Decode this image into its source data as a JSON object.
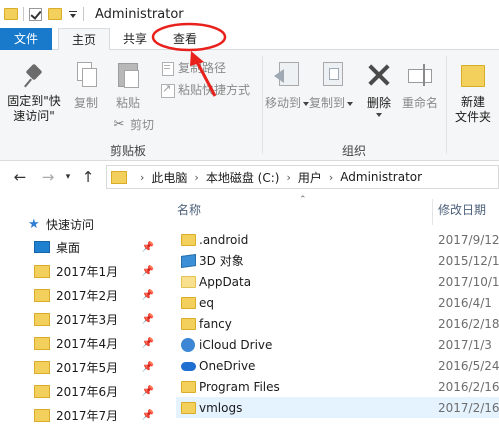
{
  "window": {
    "title": "Administrator"
  },
  "ribbon_tabs": {
    "file": "文件",
    "home": "主页",
    "share": "共享",
    "view": "查看"
  },
  "clipboard": {
    "pin_line1": "固定到\"快",
    "pin_line2": "速访问\"",
    "copy": "复制",
    "paste": "粘贴",
    "copy_path": "复制路径",
    "paste_shortcut": "粘贴快捷方式",
    "cut": "剪切",
    "group_label": "剪贴板"
  },
  "organize": {
    "move_to": "移动到",
    "copy_to": "复制到",
    "delete": "删除",
    "rename": "重命名",
    "group_label": "组织"
  },
  "new_group": {
    "new_folder_line1": "新建",
    "new_folder_line2": "文件夹"
  },
  "breadcrumb": [
    "此电脑",
    "本地磁盘 (C:)",
    "用户",
    "Administrator"
  ],
  "nav_pane": {
    "quick_access": "快速访问",
    "items": [
      {
        "label": "桌面",
        "icon": "desktop-icon"
      },
      {
        "label": "2017年1月",
        "icon": "folder-icon"
      },
      {
        "label": "2017年2月",
        "icon": "folder-icon"
      },
      {
        "label": "2017年3月",
        "icon": "folder-icon"
      },
      {
        "label": "2017年4月",
        "icon": "folder-icon"
      },
      {
        "label": "2017年5月",
        "icon": "folder-icon"
      },
      {
        "label": "2017年6月",
        "icon": "folder-icon"
      },
      {
        "label": "2017年7月",
        "icon": "folder-icon"
      }
    ]
  },
  "file_list": {
    "columns": {
      "name": "名称",
      "date": "修改日期"
    },
    "rows": [
      {
        "name": ".android",
        "date": "2017/9/12",
        "icon": "folder-icon"
      },
      {
        "name": "3D 对象",
        "date": "2015/12/1",
        "icon": "3d-objects-icon"
      },
      {
        "name": "AppData",
        "date": "2017/10/1",
        "icon": "folder-icon"
      },
      {
        "name": "eq",
        "date": "2016/4/1",
        "icon": "folder-icon"
      },
      {
        "name": "fancy",
        "date": "2016/2/18",
        "icon": "folder-icon"
      },
      {
        "name": "iCloud Drive",
        "date": "2017/1/3",
        "icon": "icloud-icon"
      },
      {
        "name": "OneDrive",
        "date": "2016/5/24",
        "icon": "onedrive-icon"
      },
      {
        "name": "Program Files",
        "date": "2016/2/16",
        "icon": "folder-icon"
      },
      {
        "name": "vmlogs",
        "date": "2017/2/16",
        "icon": "folder-icon"
      }
    ]
  },
  "colors": {
    "file_tab": "#1979ca",
    "annotation": "#e8211c",
    "ribbon_bg": "#f5f6f7",
    "folder": "#f3cf5b"
  }
}
